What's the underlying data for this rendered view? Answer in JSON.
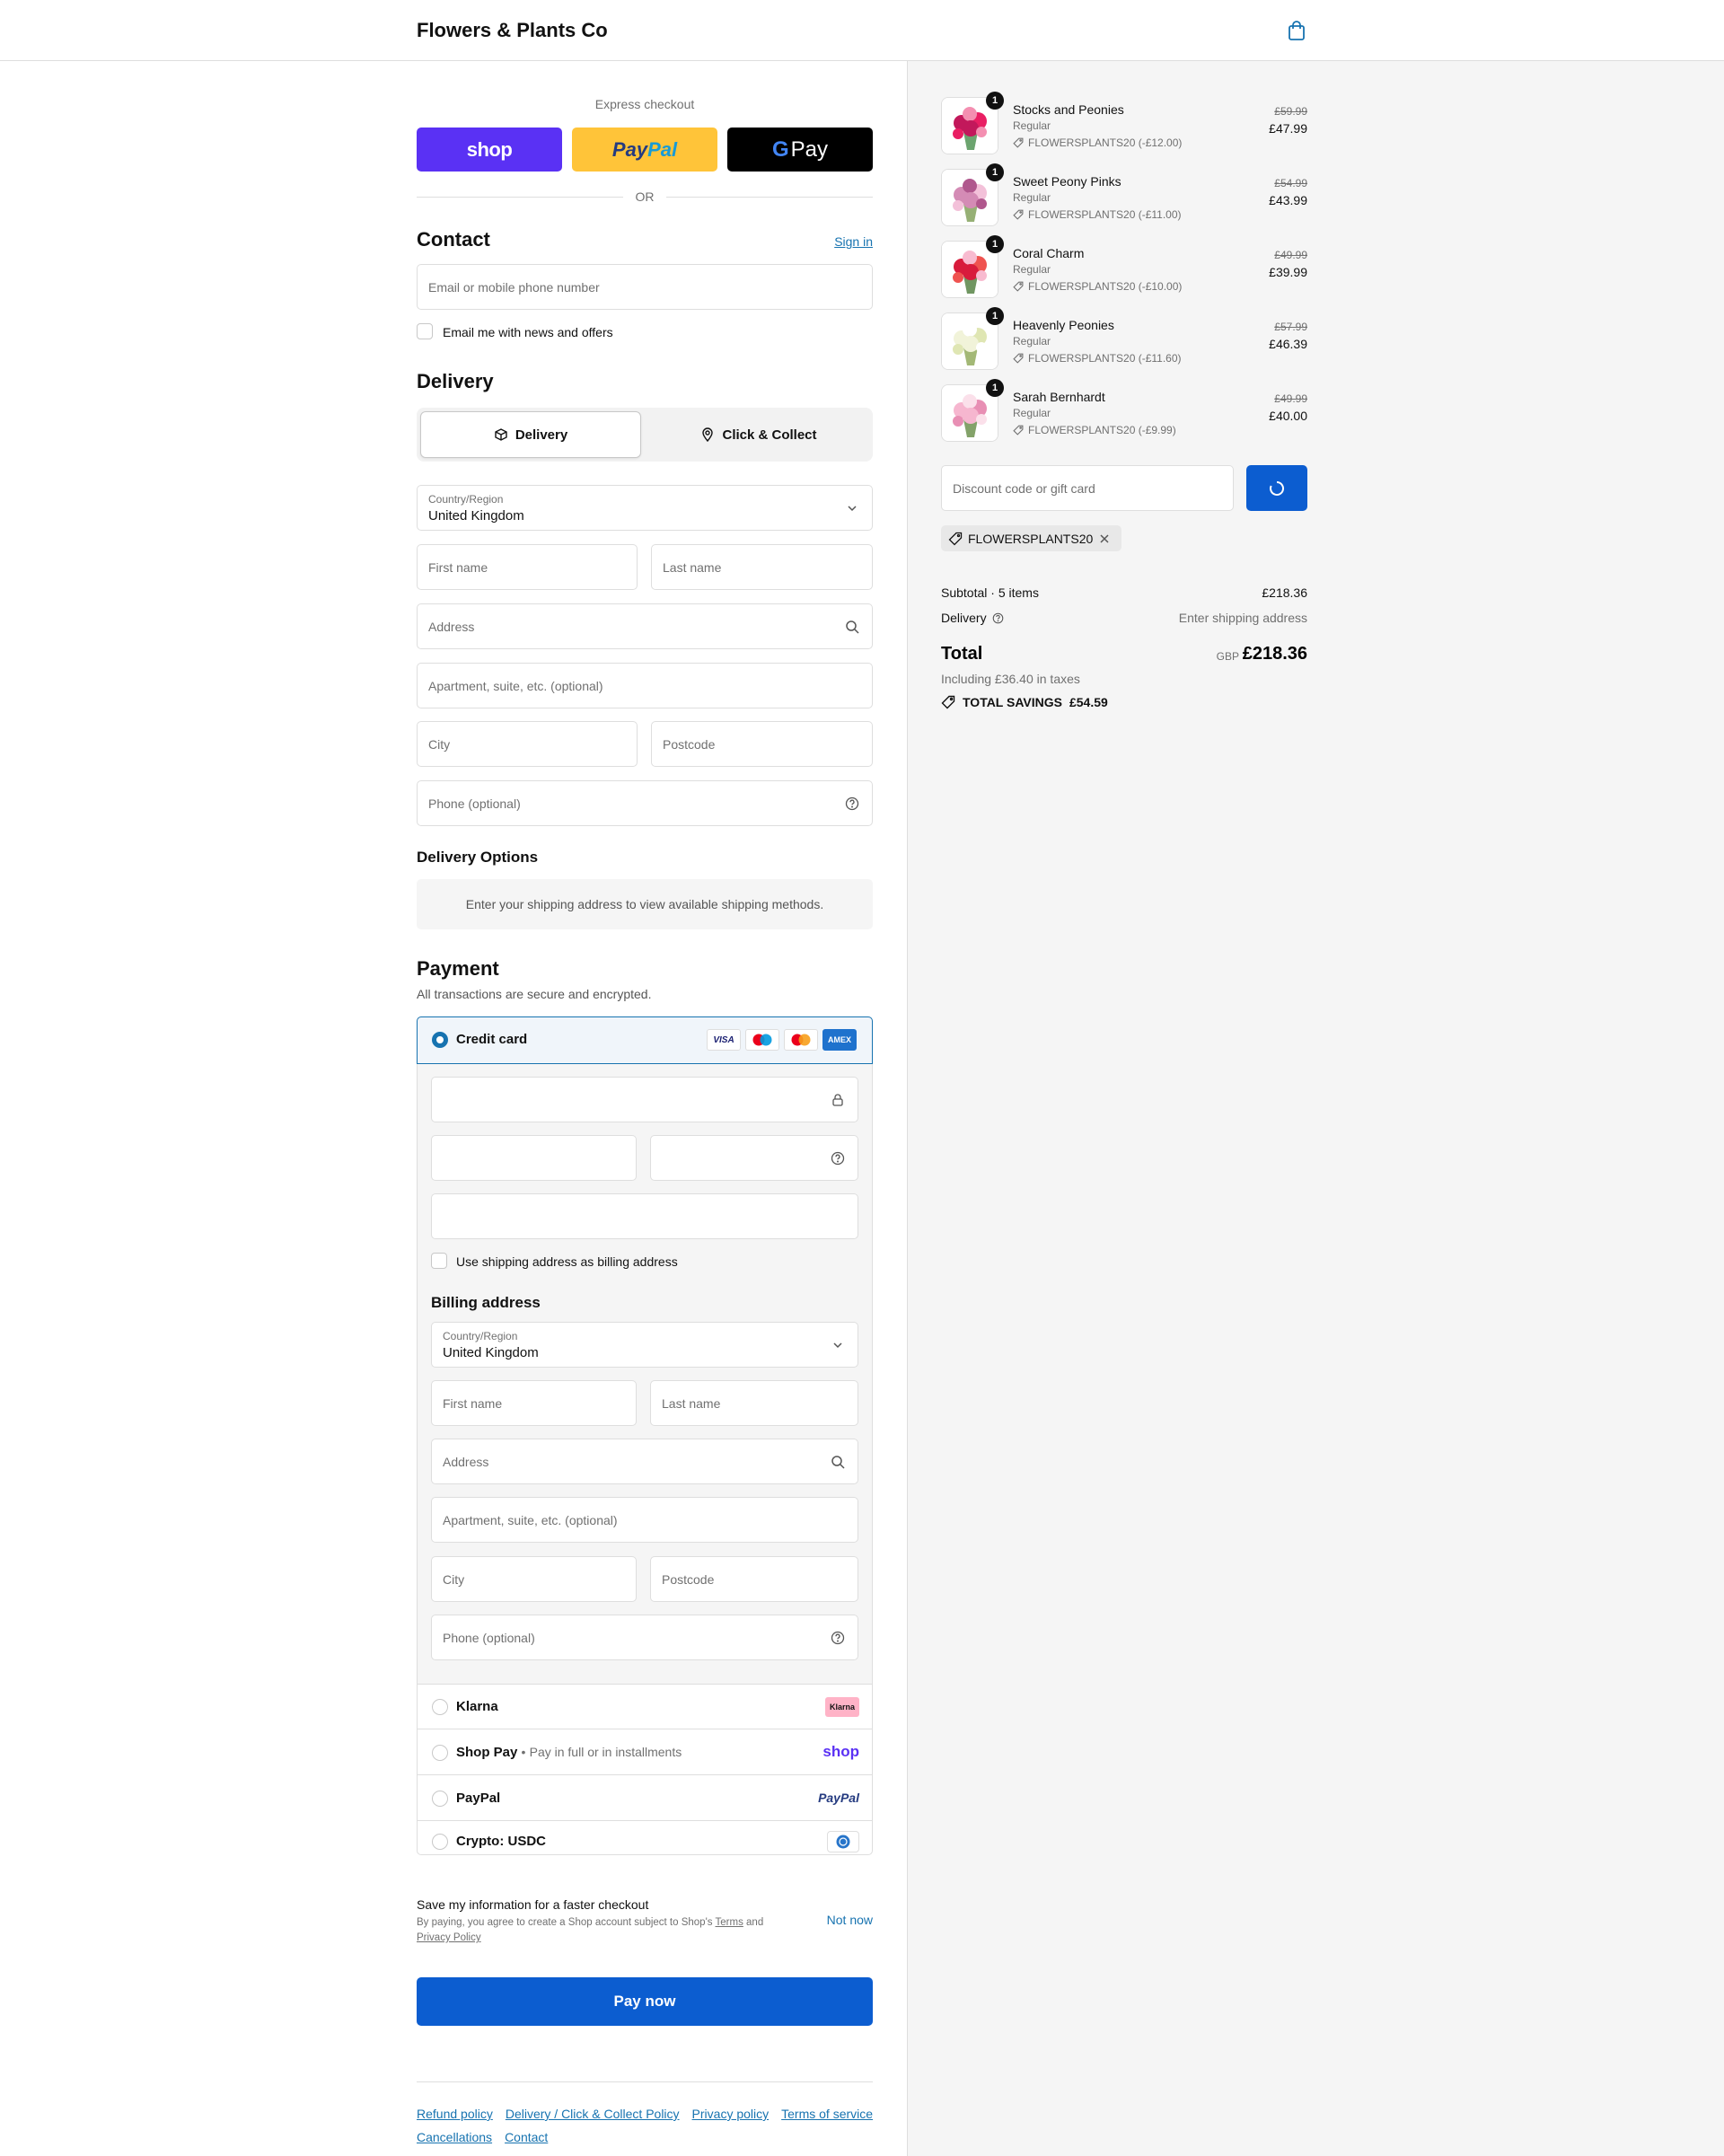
{
  "header": {
    "brand": "Flowers & Plants Co"
  },
  "express": {
    "title": "Express checkout",
    "shop": "shop",
    "paypal_a": "Pay",
    "paypal_b": "Pal",
    "gpay_g": "G",
    "gpay": "Pay",
    "or": "OR"
  },
  "contact": {
    "title": "Contact",
    "sign_in": "Sign in",
    "email_placeholder": "Email or mobile phone number",
    "news_label": "Email me with news and offers"
  },
  "delivery": {
    "title": "Delivery",
    "tab_delivery": "Delivery",
    "tab_collect": "Click & Collect",
    "country_label": "Country/Region",
    "country_value": "United Kingdom",
    "first_name": "First name",
    "last_name": "Last name",
    "address": "Address",
    "apartment": "Apartment, suite, etc. (optional)",
    "city": "City",
    "postcode": "Postcode",
    "phone": "Phone (optional)",
    "options_title": "Delivery Options",
    "options_notice": "Enter your shipping address to view available shipping methods."
  },
  "payment": {
    "title": "Payment",
    "subtitle": "All transactions are secure and encrypted.",
    "credit_card": "Credit card",
    "card_logos": [
      "VISA",
      "Maestro",
      "Mastercard",
      "AMEX"
    ],
    "use_shipping": "Use shipping address as billing address",
    "billing_title": "Billing address",
    "billing_country_label": "Country/Region",
    "billing_country_value": "United Kingdom",
    "billing_first_name": "First name",
    "billing_last_name": "Last name",
    "billing_address": "Address",
    "billing_apartment": "Apartment, suite, etc. (optional)",
    "billing_city": "City",
    "billing_postcode": "Postcode",
    "billing_phone": "Phone (optional)",
    "klarna": "Klarna",
    "klarna_logo": "Klarna",
    "shop_pay": "Shop Pay",
    "shop_pay_sub": "Pay in full or in installments",
    "shop_pay_logo": "shop",
    "paypal": "PayPal",
    "paypal_logo": "PayPal",
    "crypto": "Crypto: USDC"
  },
  "save_info": {
    "title": "Save my information for a faster checkout",
    "desc_a": "By paying, you agree to create a Shop account subject to Shop's ",
    "terms": "Terms",
    "desc_b": " and ",
    "privacy": "Privacy Policy",
    "not_now": "Not now"
  },
  "pay_now": "Pay now",
  "footer": {
    "links": [
      "Refund policy",
      "Delivery / Click & Collect Policy",
      "Privacy policy",
      "Terms of service",
      "Cancellations",
      "Contact"
    ]
  },
  "summary": {
    "items": [
      {
        "qty": "1",
        "name": "Stocks and Peonies",
        "variant": "Regular",
        "discount": "FLOWERSPLANTS20 (-£12.00)",
        "old_price": "£59.99",
        "price": "£47.99",
        "colors": [
          "#c2185b",
          "#e91e63",
          "#f48fb1",
          "#2e7d32"
        ]
      },
      {
        "qty": "1",
        "name": "Sweet Peony Pinks",
        "variant": "Regular",
        "discount": "FLOWERSPLANTS20 (-£11.00)",
        "old_price": "£54.99",
        "price": "£43.99",
        "colors": [
          "#d48bb5",
          "#f3c1d9",
          "#b0578d",
          "#6a8f3a"
        ]
      },
      {
        "qty": "1",
        "name": "Coral Charm",
        "variant": "Regular",
        "discount": "FLOWERSPLANTS20 (-£10.00)",
        "old_price": "£49.99",
        "price": "£39.99",
        "colors": [
          "#d81b3c",
          "#ef5350",
          "#f8bbd0",
          "#33691e"
        ]
      },
      {
        "qty": "1",
        "name": "Heavenly Peonies",
        "variant": "Regular",
        "discount": "FLOWERSPLANTS20 (-£11.60)",
        "old_price": "£57.99",
        "price": "£46.39",
        "colors": [
          "#f1f3d9",
          "#dfe6b3",
          "#ffffff",
          "#7c9a3c"
        ]
      },
      {
        "qty": "1",
        "name": "Sarah Bernhardt",
        "variant": "Regular",
        "discount": "FLOWERSPLANTS20 (-£9.99)",
        "old_price": "£49.99",
        "price": "£40.00",
        "colors": [
          "#f6b6cf",
          "#e88fb4",
          "#fbe0ea",
          "#4f7a2a"
        ]
      }
    ],
    "discount_placeholder": "Discount code or gift card",
    "applied_code": "FLOWERSPLANTS20",
    "subtotal_label": "Subtotal · 5 items",
    "subtotal_value": "£218.36",
    "delivery_label": "Delivery",
    "delivery_value": "Enter shipping address",
    "total_label": "Total",
    "currency": "GBP",
    "total_value": "£218.36",
    "taxes": "Including £36.40 in taxes",
    "savings_label": "TOTAL SAVINGS",
    "savings_value": "£54.59"
  },
  "colors": {
    "accent": "#1773b0",
    "pay_button": "#0c5dd0",
    "shop_purple": "#5a31f4",
    "paypal_yellow": "#ffc439"
  }
}
